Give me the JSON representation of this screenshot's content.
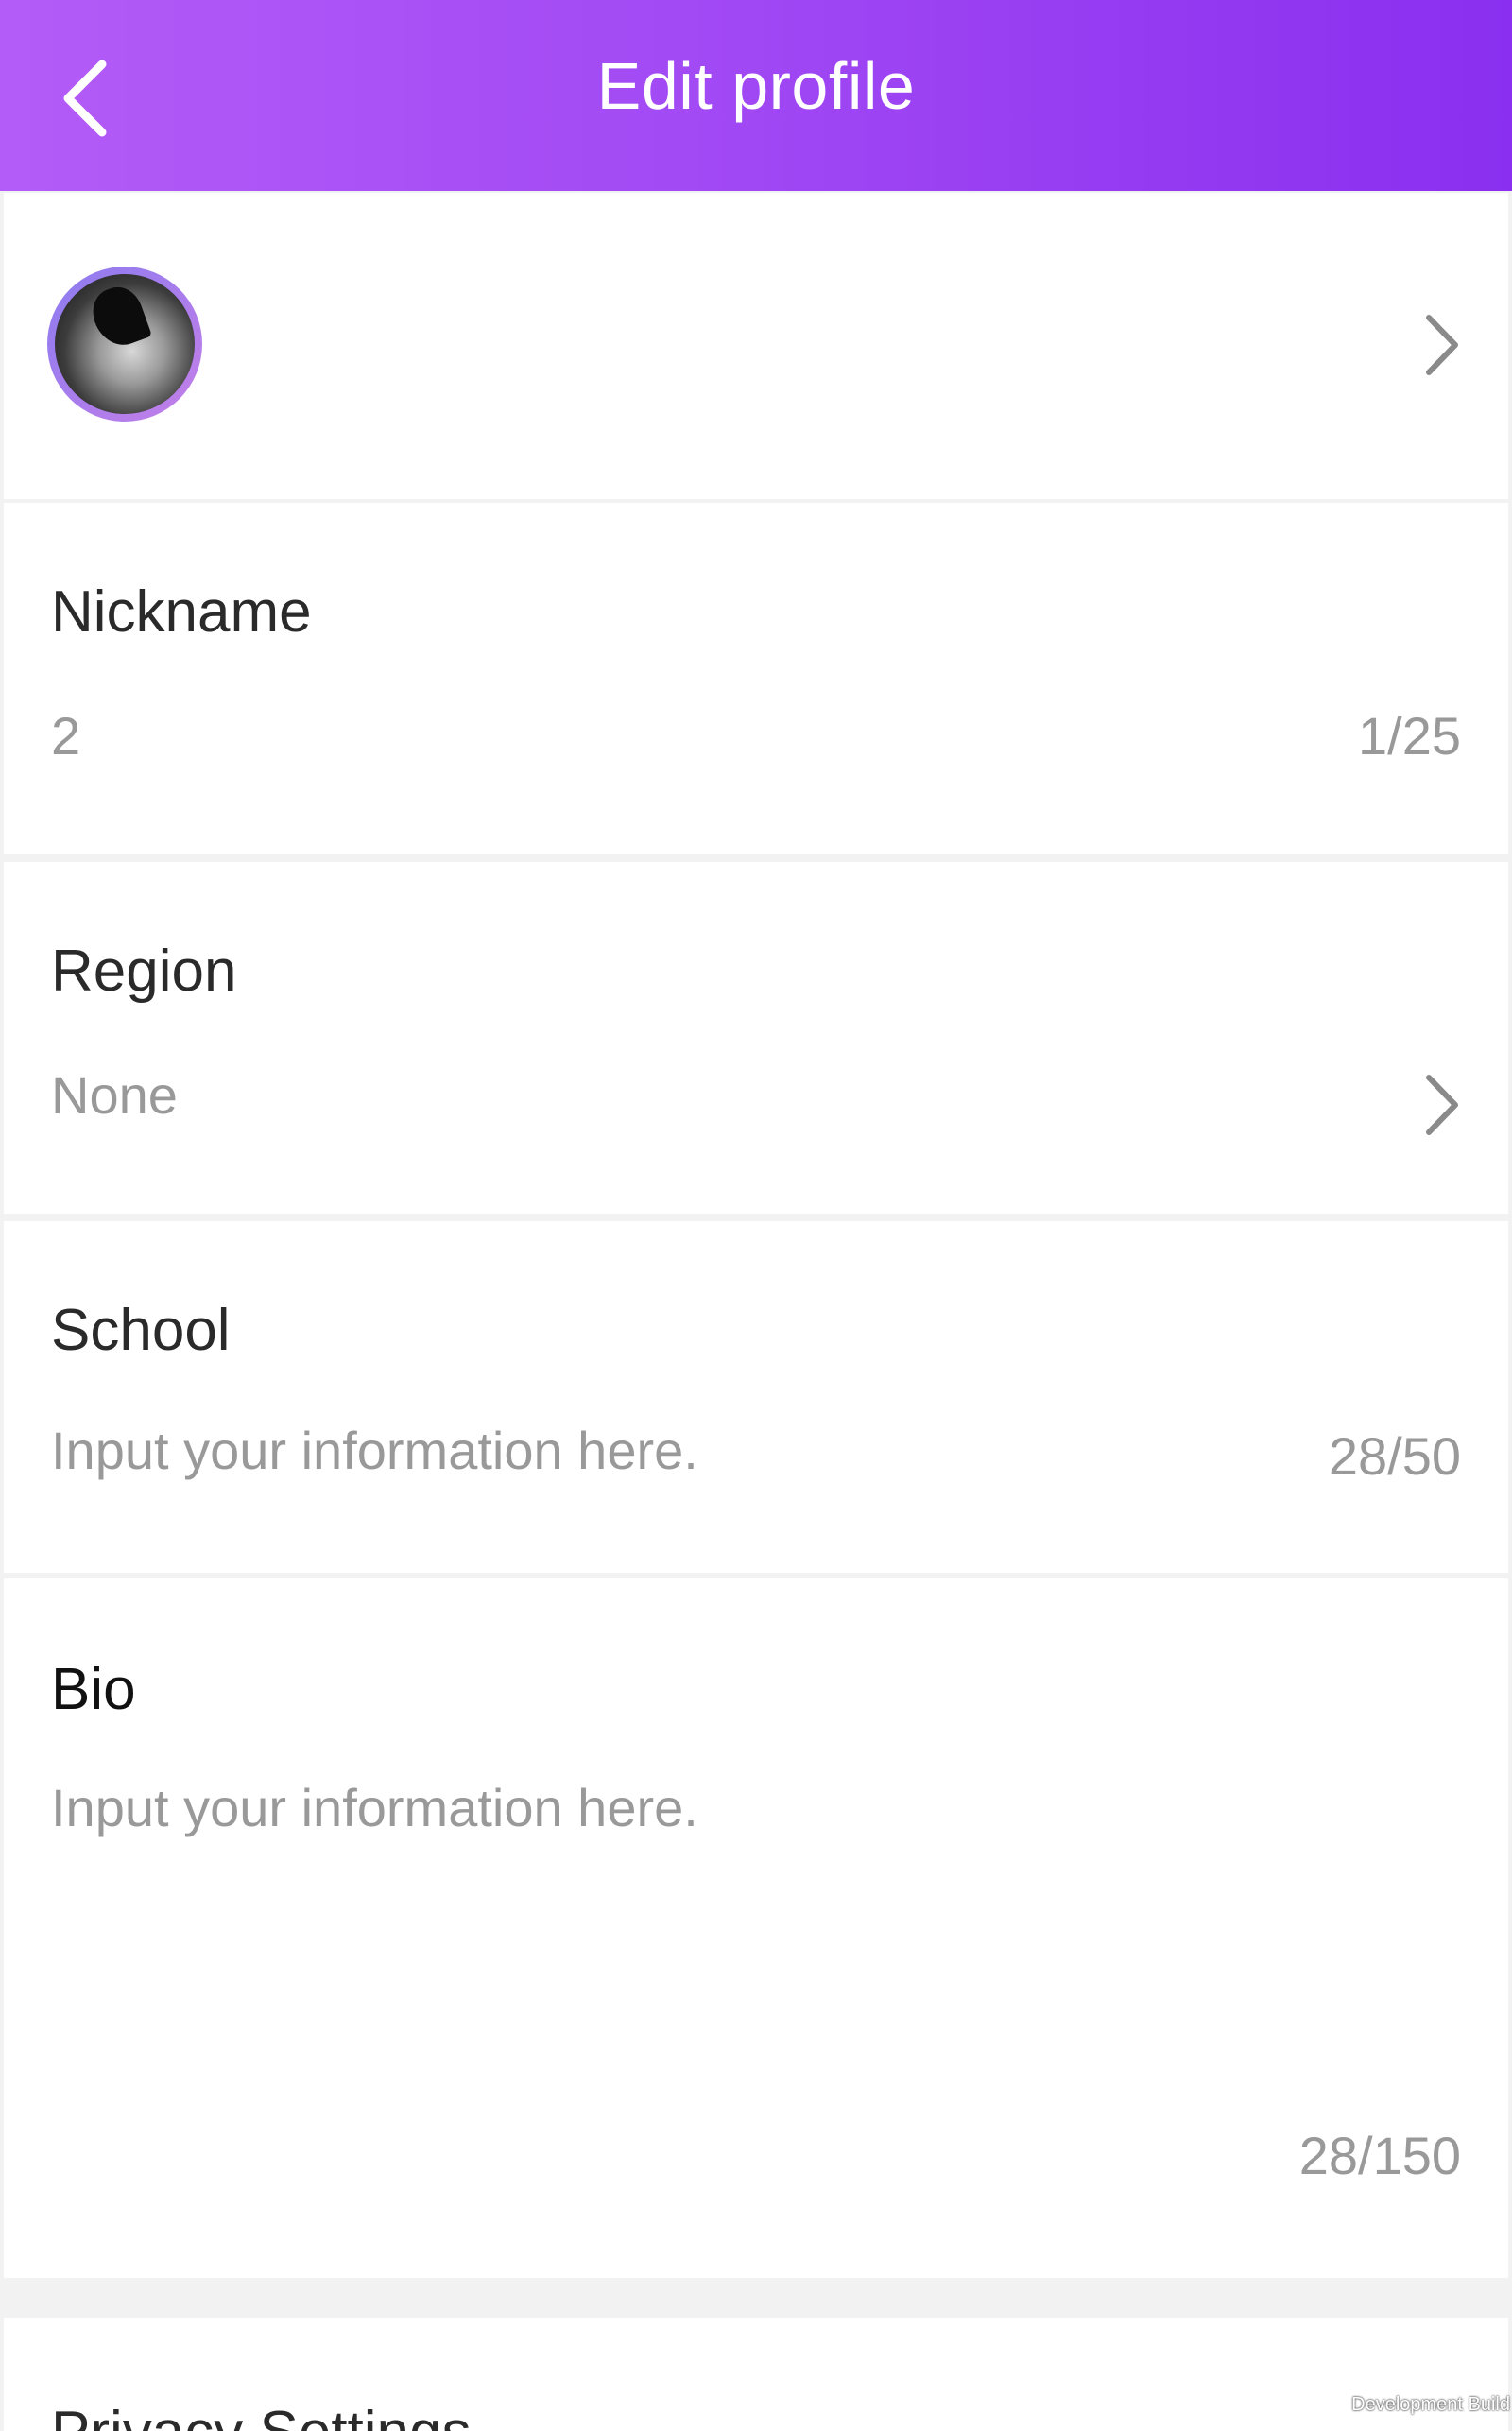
{
  "header": {
    "title": "Edit profile",
    "back_icon": "chevron-left-icon",
    "gradient": [
      "#b45cf7",
      "#8a2fef"
    ]
  },
  "avatar_row": {
    "chevron_icon": "chevron-right-icon"
  },
  "nickname": {
    "label": "Nickname",
    "value": "2",
    "counter": "1/25"
  },
  "region": {
    "label": "Region",
    "value": "None",
    "chevron_icon": "chevron-right-icon"
  },
  "school": {
    "label": "School",
    "placeholder": "Input your information here.",
    "counter": "28/50"
  },
  "bio": {
    "label": "Bio",
    "placeholder": "Input your information here.",
    "counter": "28/150"
  },
  "next_section": {
    "label": "Privacy Settings"
  },
  "watermark": "Development Build"
}
